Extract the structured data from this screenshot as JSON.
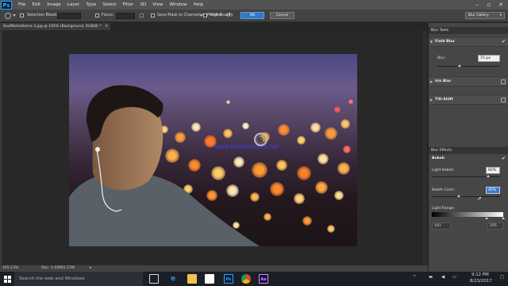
{
  "menubar": {
    "logo": "Ps",
    "items": [
      "File",
      "Edit",
      "Image",
      "Layer",
      "Type",
      "Select",
      "Filter",
      "3D",
      "View",
      "Window",
      "Help"
    ]
  },
  "options": {
    "selection_bleed_label": "Selection Bleed:",
    "focus_label": "Focus:",
    "save_mask_label": "Save Mask to Channels",
    "high_quality_label": "High Quality",
    "preview_label": "Preview",
    "ok_label": "OK",
    "cancel_label": "Cancel",
    "workspace_select": "Blur Gallery"
  },
  "document": {
    "tab_title": "RoofNotreDame-3.jpg @ 105% (Background, RGB/8) *",
    "watermark": "www.thundershare.net",
    "zoom": "105.13%",
    "doc_size": "Doc: 1.03M/2.57M"
  },
  "blur_tools": {
    "panel_title": "Blur Tools",
    "field_blur": {
      "label": "Field Blur",
      "blur_label": "Blur:",
      "blur_value": "15 px",
      "slider_fraction": 0.35
    },
    "iris_blur": "Iris Blur",
    "tilt_shift": "Tilt-Shift"
  },
  "blur_effects": {
    "panel_title": "Blur Effects",
    "bokeh_label": "Bokeh",
    "light_bokeh_label": "Light Bokeh:",
    "light_bokeh_value": "82%",
    "light_bokeh_fraction": 0.82,
    "bokeh_color_label": "Bokeh Color:",
    "bokeh_color_value": "40%",
    "bokeh_color_fraction": 0.4,
    "light_range_label": "Light Range:",
    "light_range_low": "191",
    "light_range_high": "255"
  },
  "taskbar": {
    "search_placeholder": "Search the web and Windows",
    "app_icons": [
      "task-view",
      "edge",
      "file-explorer",
      "store",
      "photoshop",
      "chrome",
      "after-effects"
    ],
    "time": "9:12 PM",
    "date": "8/23/2017"
  },
  "colors": {
    "ok_button": "#3278c9",
    "photoshop_blue": "#31a8ff",
    "panel_bg": "#464646"
  }
}
